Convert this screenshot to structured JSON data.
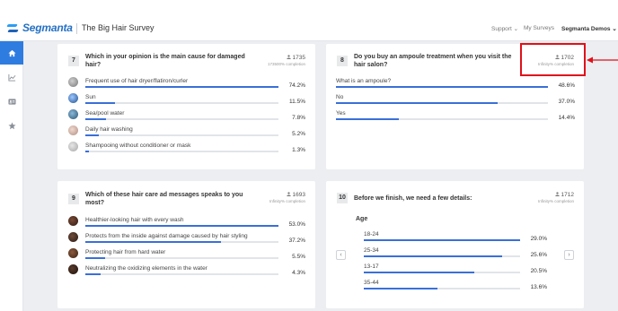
{
  "topbar": {
    "brand": "Segmanta",
    "survey_title": "The Big Hair Survey",
    "support": "Support ⌄",
    "my_surveys": "My Surveys",
    "org": "Segmanta Demos ⌄"
  },
  "sidebar": {
    "items": [
      {
        "icon": "home-icon",
        "active": true
      },
      {
        "icon": "chart-icon",
        "active": false
      },
      {
        "icon": "id-card-icon",
        "active": false
      },
      {
        "icon": "star-icon",
        "active": false
      }
    ]
  },
  "q7": {
    "number": "7",
    "title": "Which in your opinion is the main cause for damaged hair?",
    "count": "1735",
    "completion": "173500% completion",
    "answers": [
      {
        "label": "Frequent use of hair dryer/flatiron/curler",
        "pct": "74.2%",
        "value": 74.2,
        "icon": "hair-dryer-icon"
      },
      {
        "label": "Sun",
        "pct": "11.5%",
        "value": 11.5,
        "icon": "sun-icon"
      },
      {
        "label": "Sea/pool water",
        "pct": "7.8%",
        "value": 7.8,
        "icon": "water-icon"
      },
      {
        "label": "Daily hair washing",
        "pct": "5.2%",
        "value": 5.2,
        "icon": "hair-washing-icon"
      },
      {
        "label": "Shampooing without conditioner or mask",
        "pct": "1.3%",
        "value": 1.3,
        "icon": "shampoo-icon"
      }
    ]
  },
  "q8": {
    "number": "8",
    "title": "Do you buy an ampoule treatment when you visit the hair salon?",
    "count": "1702",
    "completion": "Infinity% completion",
    "answers": [
      {
        "label": "What is an ampoule?",
        "pct": "48.6%",
        "value": 48.6
      },
      {
        "label": "No",
        "pct": "37.0%",
        "value": 37.0
      },
      {
        "label": "Yes",
        "pct": "14.4%",
        "value": 14.4
      }
    ]
  },
  "q9": {
    "number": "9",
    "title": "Which of these hair care ad messages speaks to you most?",
    "count": "1693",
    "completion": "Infinity% completion",
    "answers": [
      {
        "label": "Healthier-looking hair with every wash",
        "pct": "53.0%",
        "value": 53.0,
        "icon": "hair-photo-1-icon"
      },
      {
        "label": "Protects from the inside against damage caused by hair styling",
        "pct": "37.2%",
        "value": 37.2,
        "icon": "hair-photo-2-icon"
      },
      {
        "label": "Protecting hair from hard water",
        "pct": "5.5%",
        "value": 5.5,
        "icon": "hair-photo-3-icon"
      },
      {
        "label": "Neutralizing the oxidizing elements in the water",
        "pct": "4.3%",
        "value": 4.3,
        "icon": "hair-photo-4-icon"
      }
    ]
  },
  "q10": {
    "number": "10",
    "title": "Before we finish, we need a few details:",
    "count": "1712",
    "completion": "Infinity% completion",
    "section": "Age",
    "prev": "‹",
    "next": "›",
    "answers": [
      {
        "label": "18-24",
        "pct": "29.0%",
        "value": 29.0
      },
      {
        "label": "25-34",
        "pct": "25.6%",
        "value": 25.6
      },
      {
        "label": "13-17",
        "pct": "20.5%",
        "value": 20.5
      },
      {
        "label": "35-44",
        "pct": "13.6%",
        "value": 13.6
      }
    ]
  },
  "colors": {
    "accent": "#2e7ce0",
    "bar": "#3a6fd8",
    "highlight": "#e0101a"
  }
}
